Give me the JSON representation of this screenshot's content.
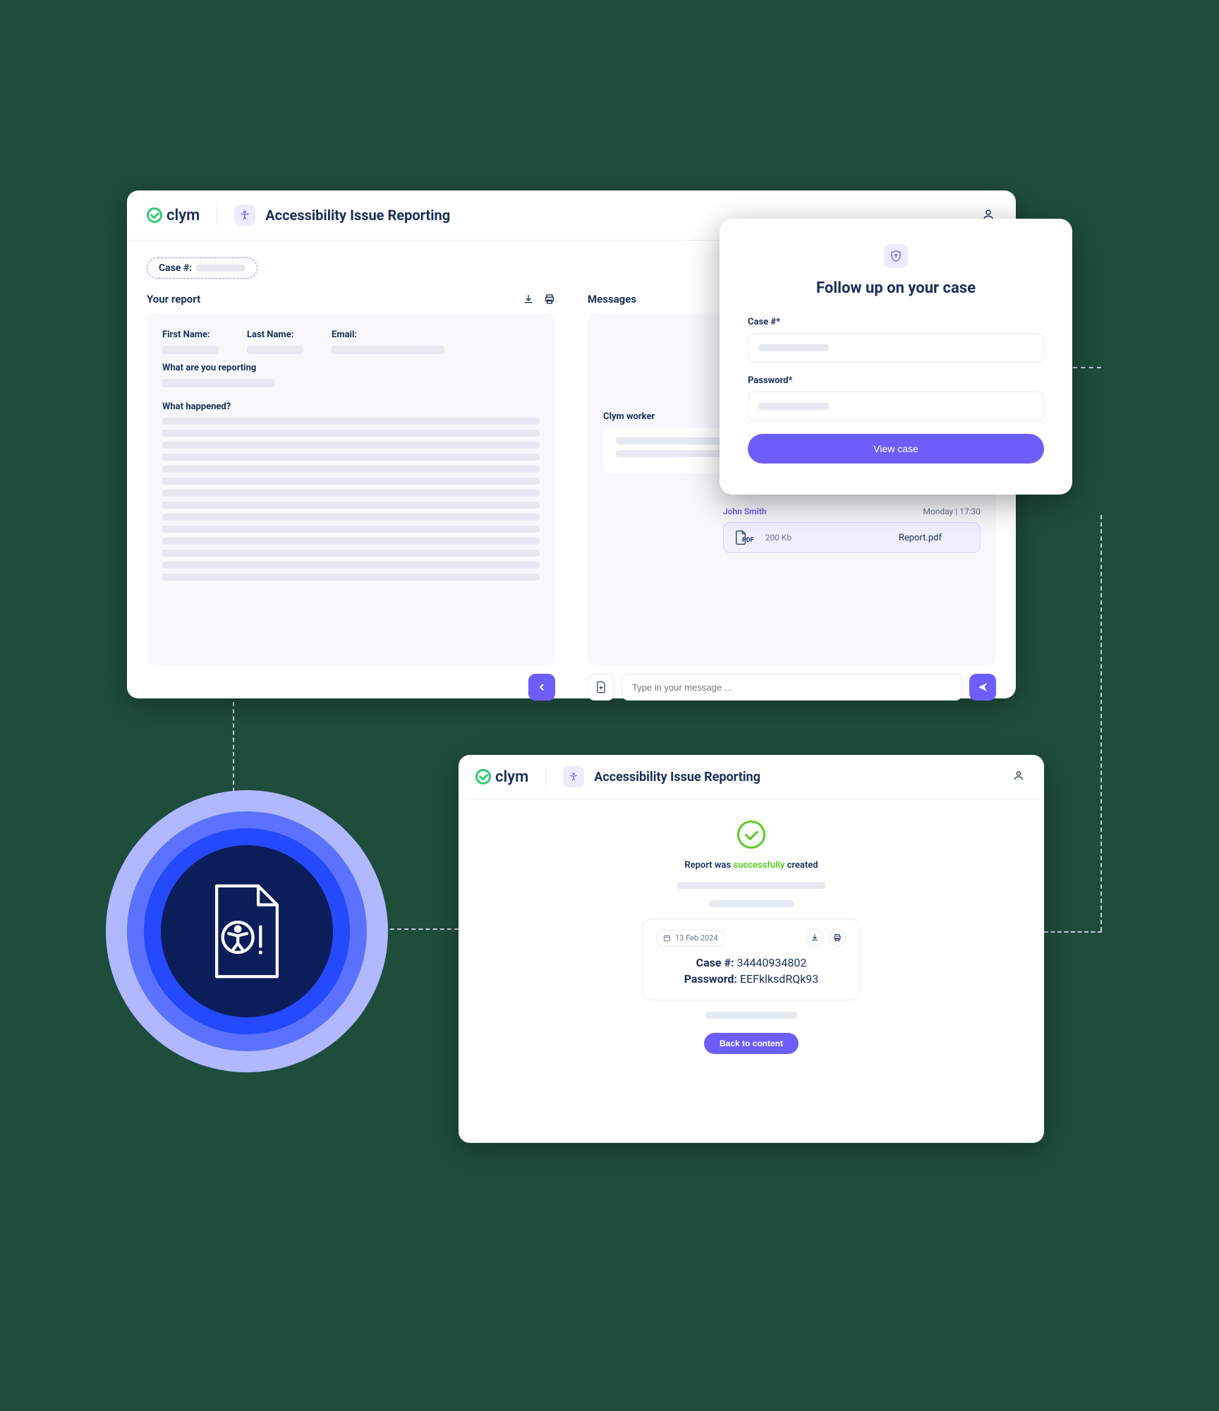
{
  "brand": "clym",
  "main": {
    "title": "Accessibility Issue Reporting",
    "caseLabel": "Case #:",
    "report": {
      "heading": "Your report",
      "firstName": "First Name:",
      "lastName": "Last Name:",
      "email": "Email:",
      "whatReporting": "What are you reporting",
      "whatHappened": "What happened?"
    },
    "messages": {
      "heading": "Messages",
      "workerLabel": "Clym worker",
      "userName": "John Smith",
      "timestamp": "Monday | 17:30",
      "fileName": "Report.pdf",
      "fileSize": "200 Kb",
      "placeholder": "Type in your message ..."
    }
  },
  "follow": {
    "title": "Follow up on your case",
    "caseLabel": "Case #*",
    "passwordLabel": "Password*",
    "button": "View case"
  },
  "success": {
    "title": "Accessibility Issue Reporting",
    "prefix": "Report was ",
    "highlight": "successfully",
    "suffix": " created",
    "date": "13 Feb 2024",
    "caseLabel": "Case #:",
    "caseValue": "34440934802",
    "passwordLabel": "Password:",
    "passwordValue": "EEFklksdRQk93",
    "back": "Back to content"
  },
  "filePdfLabel": "PDF"
}
